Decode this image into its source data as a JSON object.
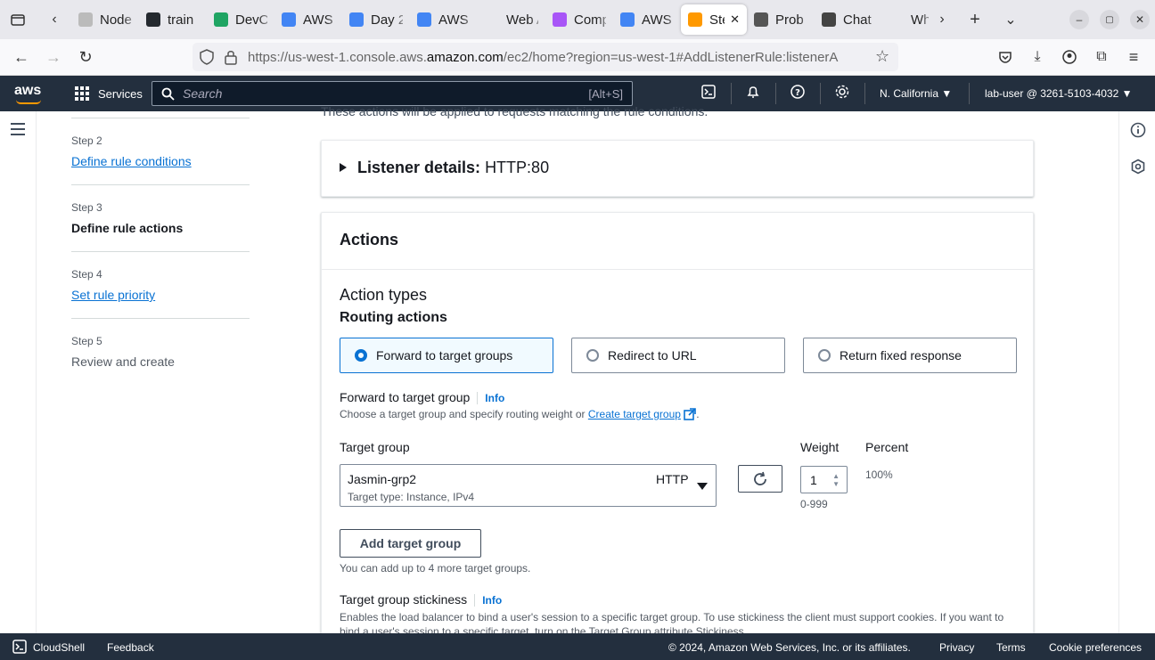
{
  "browser": {
    "tabs": [
      {
        "label": "Node Ex",
        "favicon_color": "#bbbbbb"
      },
      {
        "label": "train",
        "favicon_color": "#24292f"
      },
      {
        "label": "DevO",
        "favicon_color": "#1fa463"
      },
      {
        "label": "AWS",
        "favicon_color": "#4285f4"
      },
      {
        "label": "Day 2",
        "favicon_color": "#4285f4"
      },
      {
        "label": "AWS",
        "favicon_color": "#4285f4"
      },
      {
        "label": "Web Ap",
        "favicon_color": "#e8e8ed"
      },
      {
        "label": "Comp",
        "favicon_color": "#a855f7"
      },
      {
        "label": "AWS",
        "favicon_color": "#4285f4"
      },
      {
        "label": "Ste",
        "favicon_color": "#ff9900"
      },
      {
        "label": "Prob",
        "favicon_color": "#555555"
      },
      {
        "label": "Chat",
        "favicon_color": "#444444"
      },
      {
        "label": "Wh",
        "favicon_color": "#e8e8ed"
      }
    ],
    "url_prefix": "https://us-west-1.console.aws.",
    "url_domain": "amazon.com",
    "url_suffix": "/ec2/home?region=us-west-1#AddListenerRule:listenerA"
  },
  "aws_nav": {
    "logo": "aws",
    "services_label": "Services",
    "search_placeholder": "Search",
    "search_shortcut": "[Alt+S]",
    "region": "N. California ▼",
    "account": "lab-user @ 3261-5103-4032 ▼"
  },
  "steps": [
    {
      "num": "Step 2",
      "title": "Define rule conditions",
      "state": "link"
    },
    {
      "num": "Step 3",
      "title": "Define rule actions",
      "state": "current"
    },
    {
      "num": "Step 4",
      "title": "Set rule priority",
      "state": "link"
    },
    {
      "num": "Step 5",
      "title": "Review and create",
      "state": "disabled"
    }
  ],
  "main": {
    "clipped_note": "These actions will be applied to requests matching the rule conditions.",
    "listener_label": "Listener details:",
    "listener_value": "HTTP:80",
    "actions_header": "Actions",
    "action_types_heading": "Action types",
    "routing_heading": "Routing actions",
    "routing_options": [
      "Forward to target groups",
      "Redirect to URL",
      "Return fixed response"
    ],
    "selected_routing": "Forward to target groups",
    "forward_label": "Forward to target group",
    "info": "Info",
    "forward_desc": "Choose a target group and specify routing weight or",
    "create_tg_link": "Create target group",
    "target_group_col": "Target group",
    "weight_col": "Weight",
    "percent_col": "Percent",
    "tg_name": "Jasmin-grp2",
    "tg_protocol": "HTTP",
    "tg_type": "Target type: Instance, IPv4",
    "weight_value": "1",
    "weight_range": "0-999",
    "percent_value": "100%",
    "add_tg_button": "Add target group",
    "add_tg_note": "You can add up to 4 more target groups.",
    "stickiness_label": "Target group stickiness",
    "stickiness_desc": "Enables the load balancer to bind a user's session to a specific target group. To use stickiness the client must support cookies. If you want to bind a user's session to a specific target, turn on the Target Group attribute Stickiness."
  },
  "footer": {
    "cloudshell": "CloudShell",
    "feedback": "Feedback",
    "copyright": "© 2024, Amazon Web Services, Inc. or its affiliates.",
    "privacy": "Privacy",
    "terms": "Terms",
    "cookies": "Cookie preferences"
  },
  "colors": {
    "aws_nav": "#232f3e",
    "accent": "#0972d3",
    "aws_orange": "#ff9900"
  }
}
